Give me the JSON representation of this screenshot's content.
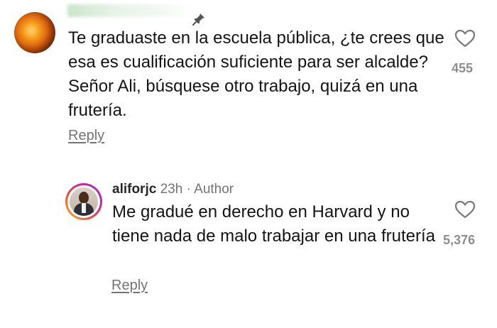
{
  "comment_1": {
    "text": "Te graduaste en la escuela pública, ¿te crees que esa es cualificación suficiente para ser alcalde? Señor Ali, búsquese otro trabajo, quizá en una frutería.",
    "like_count": "455",
    "reply_label": "Reply"
  },
  "comment_2": {
    "username": "aliforjc",
    "time": "23h",
    "separator": " · ",
    "role": "Author",
    "text": "Me gradué en derecho en Harvard y no tiene nada de malo trabajar en una frutería",
    "like_count": "5,376",
    "reply_label": "Reply"
  },
  "icons": {
    "pin": "pin-icon",
    "like": "heart-outline-icon"
  },
  "colors": {
    "text": "#141414",
    "muted": "#737373",
    "count": "#8e8e8e"
  }
}
